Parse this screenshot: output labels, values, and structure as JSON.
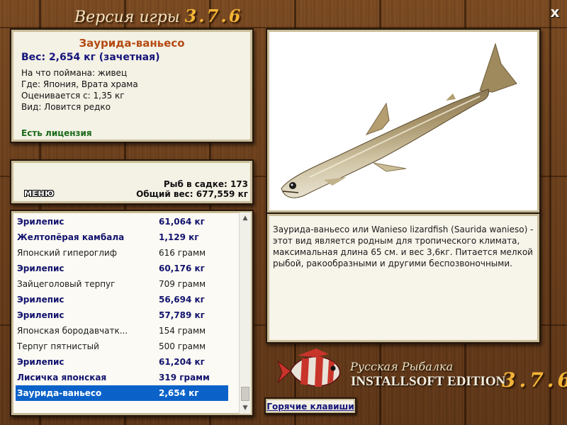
{
  "window": {
    "title_prefix": "Версия игры",
    "version": "3.7.6",
    "close_label": "x"
  },
  "catch_info": {
    "fish_name": "Заурида-ваньесо",
    "weight": "Вес: 2,654 кг (зачетная)",
    "details": [
      "На что поймана: живец",
      "Где: Япония, Врата храма",
      "Оценивается с: 1,35 кг",
      "Вид: Ловится редко"
    ],
    "license": "Есть лицензия"
  },
  "summary": {
    "menu_label": "МЕНЮ",
    "fish_count": "Рыб в садке: 173",
    "total_weight": "Общий вес: 677,559 кг"
  },
  "catch_list": [
    {
      "name": "Эрилепис",
      "weight": "61,064 кг",
      "bold": true
    },
    {
      "name": "Желтопёрая камбала",
      "weight": "1,129 кг",
      "bold": true
    },
    {
      "name": "Японский гипероглиф",
      "weight": "616 грамм",
      "bold": false
    },
    {
      "name": "Эрилепис",
      "weight": "60,176 кг",
      "bold": true
    },
    {
      "name": "Зайцеголовый терпуг",
      "weight": "709 грамм",
      "bold": false
    },
    {
      "name": "Эрилепис",
      "weight": "56,694 кг",
      "bold": true
    },
    {
      "name": "Эрилепис",
      "weight": "57,789 кг",
      "bold": true
    },
    {
      "name": "Японская бородавчатк...",
      "weight": "154 грамм",
      "bold": false
    },
    {
      "name": "Терпуг пятнистый",
      "weight": "500 грамм",
      "bold": false
    },
    {
      "name": "Эрилепис",
      "weight": "61,204 кг",
      "bold": true
    },
    {
      "name": "Лисичка японская",
      "weight": "319 грамм",
      "bold": true
    },
    {
      "name": "Заурида-ваньесо",
      "weight": "2,654 кг",
      "bold": true,
      "selected": true
    }
  ],
  "description": "Заурида-ваньесо или Wanieso lizardfish (Saurida wanieso) - этот вид является родным для тропического климата, максимальная длина 65 см. и вес 3,6кг. Питается мелкой рыбой, ракообразными и другими беспозвоночными.",
  "branding": {
    "line1": "Русская Рыбалка",
    "line2": "INSTALLSOFT EDITION",
    "version": "3.7.6"
  },
  "hotkeys_label": "Горячие клавиши"
}
